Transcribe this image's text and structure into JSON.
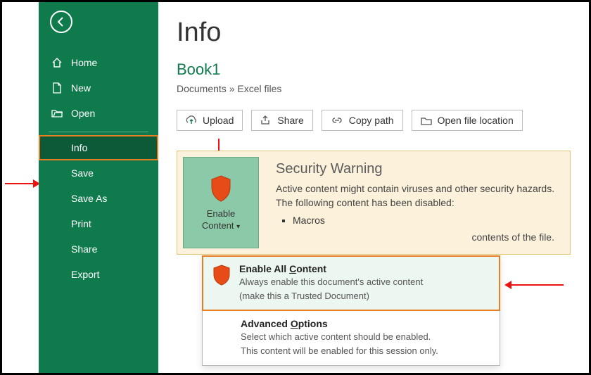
{
  "sidebar": {
    "items": [
      {
        "label": "Home",
        "icon": "home-icon"
      },
      {
        "label": "New",
        "icon": "new-icon"
      },
      {
        "label": "Open",
        "icon": "open-icon"
      }
    ],
    "lower_items": [
      {
        "label": "Info"
      },
      {
        "label": "Save"
      },
      {
        "label": "Save As"
      },
      {
        "label": "Print"
      },
      {
        "label": "Share"
      },
      {
        "label": "Export"
      }
    ],
    "active_index": 0
  },
  "page": {
    "title": "Info",
    "doc_title": "Book1",
    "breadcrumb": "Documents » Excel files"
  },
  "toolbar": {
    "upload": "Upload",
    "share": "Share",
    "copy_path": "Copy path",
    "open_location": "Open file location"
  },
  "warning": {
    "enable_button_line1": "Enable",
    "enable_button_line2": "Content",
    "title": "Security Warning",
    "text": "Active content might contain viruses and other security hazards. The following content has been disabled:",
    "list": [
      "Macros"
    ],
    "trust_suffix": "contents of the file."
  },
  "dropdown": {
    "enable_all": {
      "title_prefix": "Enable All ",
      "title_u": "C",
      "title_suffix": "ontent",
      "sub1": "Always enable this document's active content",
      "sub2": "(make this a Trusted Document)"
    },
    "advanced": {
      "title_prefix": "Advanced ",
      "title_u": "O",
      "title_suffix": "ptions",
      "sub1": "Select which active content should be enabled.",
      "sub2": "This content will be enabled for this session only."
    }
  },
  "colors": {
    "sidebar_bg": "#0f7b4c",
    "sidebar_active": "#0c5a38",
    "highlight_border": "#e67e22",
    "warn_bg": "#fcf2dc",
    "warn_border": "#e7c678",
    "enable_btn_bg": "#8bc9a8"
  }
}
